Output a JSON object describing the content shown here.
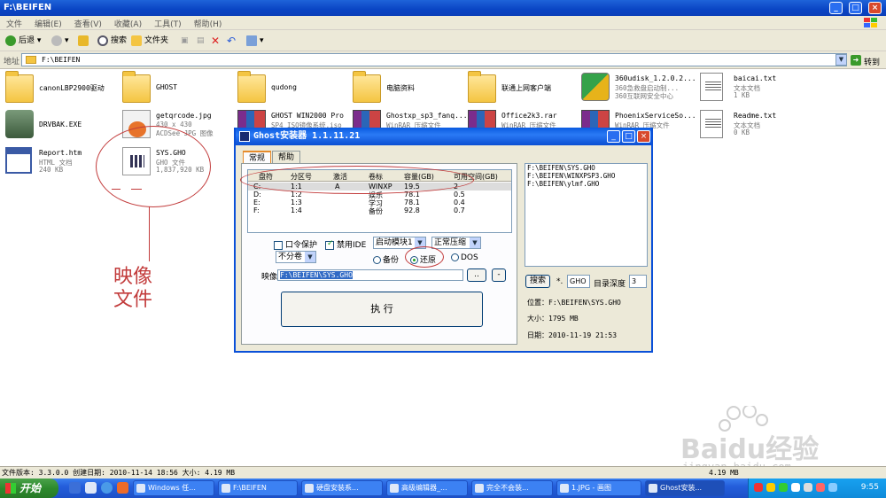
{
  "window": {
    "title": "F:\\BEIFEN"
  },
  "menu": [
    "文件",
    "编辑(E)",
    "查看(V)",
    "收藏(A)",
    "工具(T)",
    "帮助(H)"
  ],
  "toolbar": {
    "back": "后退",
    "search": "搜索",
    "folders": "文件夹"
  },
  "address": {
    "label": "地址",
    "value": "F:\\BEIFEN",
    "go": "转到"
  },
  "files": [
    {
      "name": "canonLBP2900驱动",
      "sub1": "",
      "sub2": "",
      "icon": "folder-icon"
    },
    {
      "name": "GHOST",
      "sub1": "",
      "sub2": "",
      "icon": "folder-icon"
    },
    {
      "name": "qudong",
      "sub1": "",
      "sub2": "",
      "icon": "folder-icon"
    },
    {
      "name": "电脑资料",
      "sub1": "",
      "sub2": "",
      "icon": "folder-icon"
    },
    {
      "name": "联通上网客户端",
      "sub1": "",
      "sub2": "",
      "icon": "folder-icon"
    },
    {
      "name": "360udisk_1.2.0.2...",
      "sub1": "360急救盘启动制...",
      "sub2": "360互联网安全中心",
      "icon": "360-icon"
    },
    {
      "name": "baicai.txt",
      "sub1": "文本文档",
      "sub2": "1 KB",
      "icon": "text-file-icon"
    },
    {
      "name": "DRVBAK.EXE",
      "sub1": "",
      "sub2": "",
      "icon": "exe-icon"
    },
    {
      "name": "getqrcode.jpg",
      "sub1": "430 x 430",
      "sub2": "ACDSee JPG 图像",
      "icon": "jpg-icon"
    },
    {
      "name": "GHOST WIN2000 Pro",
      "sub1": "SP4 ISO镜像系统.iso",
      "sub2": "",
      "icon": "rar-icon"
    },
    {
      "name": "Ghostxp_sp3_fanq...",
      "sub1": "WinRAR 压缩文件",
      "sub2": "",
      "icon": "rar-icon"
    },
    {
      "name": "Office2k3.rar",
      "sub1": "WinRAR 压缩文件",
      "sub2": "",
      "icon": "rar-icon"
    },
    {
      "name": "PhoenixServiceSo...",
      "sub1": "WinRAR 压缩文件",
      "sub2": "",
      "icon": "rar-icon"
    },
    {
      "name": "Readme.txt",
      "sub1": "文本文档",
      "sub2": "0 KB",
      "icon": "text-file-icon"
    },
    {
      "name": "Report.htm",
      "sub1": "HTML 文档",
      "sub2": "240 KB",
      "icon": "html-icon"
    },
    {
      "name": "SYS.GHO",
      "sub1": "GHO 文件",
      "sub2": "1,837,920 KB",
      "icon": "gho-icon"
    }
  ],
  "annotation": {
    "text": "映像文件"
  },
  "dialog": {
    "title": "Ghost安装器 1.1.11.21",
    "tabs": [
      "常规",
      "帮助"
    ],
    "table": {
      "headers": [
        "盘符",
        "分区号",
        "激活",
        "卷标",
        "容量(GB)",
        "可用空间(GB)"
      ],
      "rows": [
        [
          "C:",
          "1:1",
          "A",
          "WINXP",
          "19.5",
          "2"
        ],
        [
          "D:",
          "1:2",
          "",
          "娱乐",
          "78.1",
          "0.5"
        ],
        [
          "E:",
          "1:3",
          "",
          "学习",
          "78.1",
          "0.4"
        ],
        [
          "F:",
          "1:4",
          "",
          "备份",
          "92.8",
          "0.7"
        ]
      ]
    },
    "password_label": "口令保护",
    "disable_ide_label": "禁用IDE",
    "boot_mode": "启动模块1",
    "compress": "正常压缩",
    "split": "不分卷",
    "backup_label": "备份",
    "restore_label": "还原",
    "dos_label": "DOS",
    "image_label": "映像",
    "image_path": "F:\\BEIFEN\\SYS.GHO",
    "browse": "..",
    "minus": "-",
    "execute": "执  行",
    "file_list": [
      "F:\\BEIFEN\\SYS.GHO",
      "F:\\BEIFEN\\WINXPSP3.GHO",
      "F:\\BEIFEN\\ylmf.GHO"
    ],
    "search_btn": "搜索",
    "ext_prefix": "*.",
    "ext": "GHO",
    "depth_label": "目录深度",
    "depth": "3",
    "location": "位置：F:\\BEIFEN\\SYS.GHO",
    "size": "大小：1795 MB",
    "date": "日期：2010-11-19  21:53"
  },
  "status": {
    "text": "文件版本: 3.3.0.0 创建日期: 2010-11-14 18:56 大小: 4.19 MB",
    "right": "4.19 MB"
  },
  "taskbar": {
    "start": "开始",
    "tasks": [
      "Windows 任...",
      "F:\\BEIFEN",
      "硬盘安装系...",
      "高级编辑器_...",
      "完全不会装...",
      "1.JPG - 画图",
      "Ghost安装..."
    ],
    "clock": "9:55"
  },
  "watermark": {
    "line1": "Baidu经验",
    "line2": "jingyan.baidu.com"
  }
}
